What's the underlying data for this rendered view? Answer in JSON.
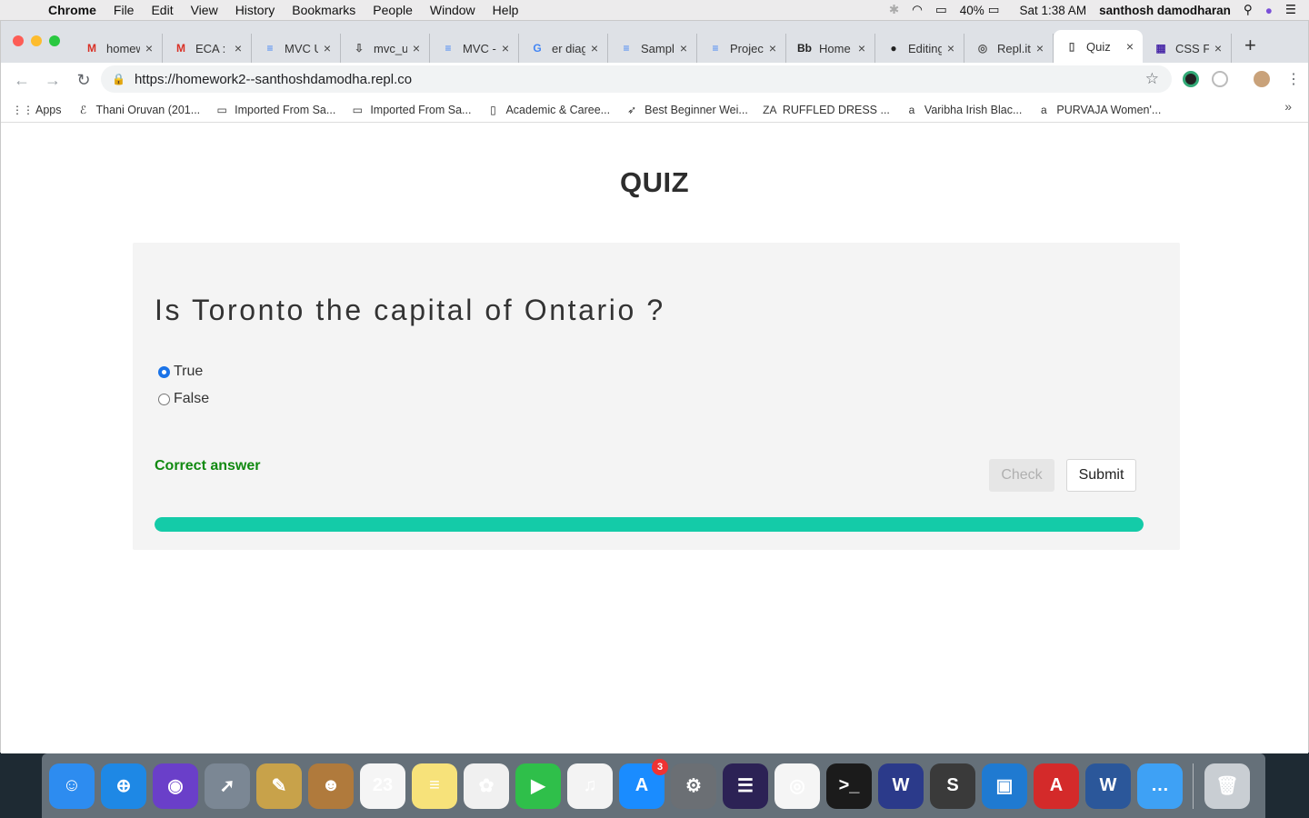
{
  "menubar": {
    "app": "Chrome",
    "items": [
      "File",
      "Edit",
      "View",
      "History",
      "Bookmarks",
      "People",
      "Window",
      "Help"
    ],
    "battery": "40%",
    "clock": "Sat 1:38 AM",
    "user": "santhosh damodharan"
  },
  "tabs": [
    {
      "title": "homew",
      "icon": "gmail-icon",
      "color": "#d93025",
      "glyph": "M"
    },
    {
      "title": "ECA :",
      "icon": "gmail-icon",
      "color": "#d93025",
      "glyph": "M"
    },
    {
      "title": "MVC U",
      "icon": "docs-icon",
      "color": "#4285f4",
      "glyph": "≡"
    },
    {
      "title": "mvc_u",
      "icon": "download-icon",
      "color": "#555",
      "glyph": "⇩"
    },
    {
      "title": "MVC -",
      "icon": "docs-icon",
      "color": "#4285f4",
      "glyph": "≡"
    },
    {
      "title": "er diag",
      "icon": "google-icon",
      "color": "#4285f4",
      "glyph": "G"
    },
    {
      "title": "Sampl",
      "icon": "docs-icon",
      "color": "#4285f4",
      "glyph": "≡"
    },
    {
      "title": "Projec",
      "icon": "docs-icon",
      "color": "#4285f4",
      "glyph": "≡"
    },
    {
      "title": "Home",
      "icon": "blackboard-icon",
      "color": "#222",
      "glyph": "Bb"
    },
    {
      "title": "Editing",
      "icon": "github-icon",
      "color": "#222",
      "glyph": "●"
    },
    {
      "title": "Repl.it",
      "icon": "replit-icon",
      "color": "#555",
      "glyph": "◎"
    },
    {
      "title": "Quiz",
      "icon": "page-icon",
      "color": "#555",
      "glyph": "▯",
      "active": true
    },
    {
      "title": "CSS F",
      "icon": "w3schools-icon",
      "color": "#4a2aa8",
      "glyph": "▦"
    }
  ],
  "omnibox": {
    "url": "https://homework2--santhoshdamodha.repl.co"
  },
  "bookmarks": [
    {
      "label": "Apps",
      "icon": "apps-grid-icon",
      "glyph": "⋮⋮"
    },
    {
      "label": "Thani Oruvan (201...",
      "icon": "script-e-icon",
      "glyph": "ℰ"
    },
    {
      "label": "Imported From Sa...",
      "icon": "folder-icon",
      "glyph": "▭"
    },
    {
      "label": "Imported From Sa...",
      "icon": "folder-icon",
      "glyph": "▭"
    },
    {
      "label": "Academic & Caree...",
      "icon": "page-icon",
      "glyph": "▯"
    },
    {
      "label": "Best Beginner Wei...",
      "icon": "bird-icon",
      "glyph": "➶"
    },
    {
      "label": "RUFFLED DRESS ...",
      "icon": "zara-icon",
      "glyph": "ZA"
    },
    {
      "label": "Varibha Irish Blac...",
      "icon": "amazon-icon",
      "glyph": "a"
    },
    {
      "label": "PURVAJA Women'...",
      "icon": "amazon-icon",
      "glyph": "a"
    }
  ],
  "quiz": {
    "title": "QUIZ",
    "question": "Is Toronto the capital of Ontario ?",
    "options": [
      {
        "label": "True",
        "selected": true
      },
      {
        "label": "False",
        "selected": false
      }
    ],
    "feedback": "Correct answer",
    "check_label": "Check",
    "submit_label": "Submit",
    "progress": 1.0,
    "colors": {
      "feedback": "#118a11",
      "progress": "#14cba8"
    }
  },
  "dock": {
    "items": [
      {
        "name": "finder-icon",
        "bg": "#2d8cf0",
        "glyph": "☺"
      },
      {
        "name": "safari-icon",
        "bg": "#1e88e5",
        "glyph": "⊕"
      },
      {
        "name": "siri-icon",
        "bg": "#6a3fc9",
        "glyph": "◉"
      },
      {
        "name": "launchpad-icon",
        "bg": "#7b8794",
        "glyph": "➚"
      },
      {
        "name": "preview-icon",
        "bg": "#c8a24a",
        "glyph": "✎"
      },
      {
        "name": "contacts-icon",
        "bg": "#b07a3c",
        "glyph": "☻"
      },
      {
        "name": "calendar-icon",
        "bg": "#f5f5f5",
        "glyph": "23"
      },
      {
        "name": "notes-icon",
        "bg": "#f7e27a",
        "glyph": "≡"
      },
      {
        "name": "photos-icon",
        "bg": "#f0f0f0",
        "glyph": "✿"
      },
      {
        "name": "facetime-icon",
        "bg": "#2fbf4a",
        "glyph": "▶"
      },
      {
        "name": "itunes-icon",
        "bg": "#f3f3f3",
        "glyph": "♫"
      },
      {
        "name": "app-store-icon",
        "bg": "#1a8cff",
        "glyph": "A",
        "badge": "3"
      },
      {
        "name": "system-preferences-icon",
        "bg": "#6b6f74",
        "glyph": "⚙"
      },
      {
        "name": "eclipse-icon",
        "bg": "#2c2255",
        "glyph": "☰"
      },
      {
        "name": "chrome-icon",
        "bg": "#f5f5f5",
        "glyph": "◎"
      },
      {
        "name": "terminal-icon",
        "bg": "#1b1b1b",
        "glyph": ">_"
      },
      {
        "name": "webstorm-icon",
        "bg": "#2b3a8a",
        "glyph": "W"
      },
      {
        "name": "sublime-icon",
        "bg": "#3a3a3a",
        "glyph": "S"
      },
      {
        "name": "bracket-app-icon",
        "bg": "#1f7ad1",
        "glyph": "▣"
      },
      {
        "name": "acrobat-icon",
        "bg": "#d42a2a",
        "glyph": "A"
      },
      {
        "name": "word-icon",
        "bg": "#2b579a",
        "glyph": "W"
      },
      {
        "name": "messages-icon",
        "bg": "#3ea1f5",
        "glyph": "…"
      }
    ],
    "trash": {
      "name": "trash-icon",
      "bg": "#c9ced3",
      "glyph": "🗑"
    }
  }
}
